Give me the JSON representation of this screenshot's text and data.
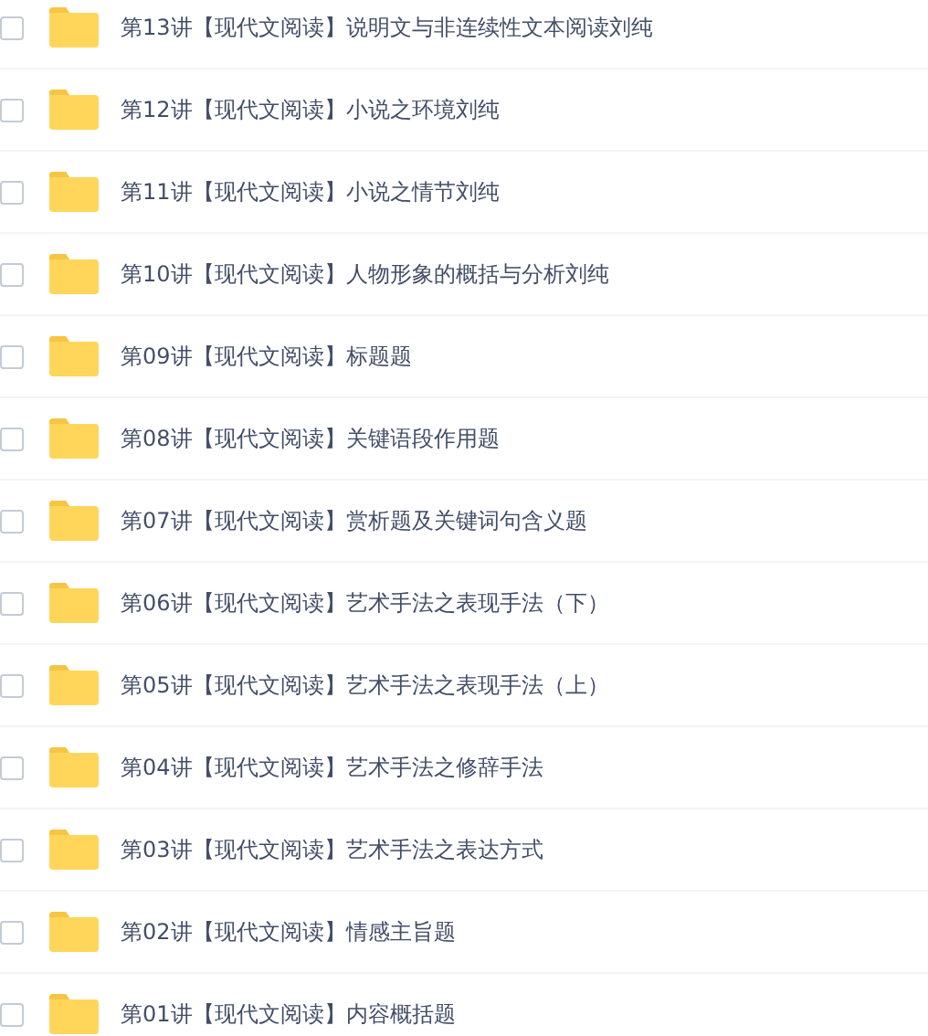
{
  "files": [
    {
      "name": "第13讲【现代文阅读】说明文与非连续性文本阅读刘纯",
      "checked": false
    },
    {
      "name": "第12讲【现代文阅读】小说之环境刘纯",
      "checked": false
    },
    {
      "name": "第11讲【现代文阅读】小说之情节刘纯",
      "checked": false
    },
    {
      "name": "第10讲【现代文阅读】人物形象的概括与分析刘纯",
      "checked": false
    },
    {
      "name": "第09讲【现代文阅读】标题题",
      "checked": false
    },
    {
      "name": "第08讲【现代文阅读】关键语段作用题",
      "checked": false
    },
    {
      "name": "第07讲【现代文阅读】赏析题及关键词句含义题",
      "checked": false
    },
    {
      "name": "第06讲【现代文阅读】艺术手法之表现手法（下）",
      "checked": false
    },
    {
      "name": "第05讲【现代文阅读】艺术手法之表现手法（上）",
      "checked": false
    },
    {
      "name": "第04讲【现代文阅读】艺术手法之修辞手法",
      "checked": false
    },
    {
      "name": "第03讲【现代文阅读】艺术手法之表达方式",
      "checked": false
    },
    {
      "name": "第02讲【现代文阅读】情感主旨题",
      "checked": false
    },
    {
      "name": "第01讲【现代文阅读】内容概括题",
      "checked": false
    }
  ]
}
